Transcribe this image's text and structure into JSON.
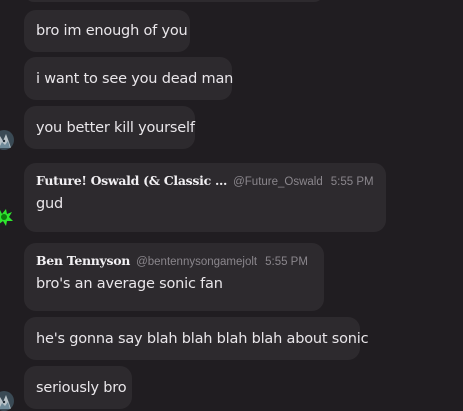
{
  "messages": [
    {
      "text": "bro im enough of you"
    },
    {
      "text": "i want to see you dead man"
    },
    {
      "text": "you better kill yourself",
      "avatar_icon": "wolf-avatar-icon"
    },
    {
      "author": "Future! Oswald (& Classic ...",
      "handle": "@Future_Oswald",
      "time": "5:55 PM",
      "text": "gud",
      "avatar_icon": "green-splat-avatar-icon"
    },
    {
      "author": "Ben Tennyson",
      "handle": "@bentennysongamejolt",
      "time": "5:55 PM",
      "text": "bro's an average sonic fan"
    },
    {
      "text": "he's gonna say blah blah blah blah about sonic"
    },
    {
      "text": "seriously bro",
      "avatar_icon": "wolf-avatar-icon"
    }
  ],
  "colors": {
    "background": "#201d21",
    "bubble": "#2d2a2e",
    "text": "#e9e6ea",
    "meta": "#8a868c",
    "avatar_green": "#2ee62e"
  }
}
